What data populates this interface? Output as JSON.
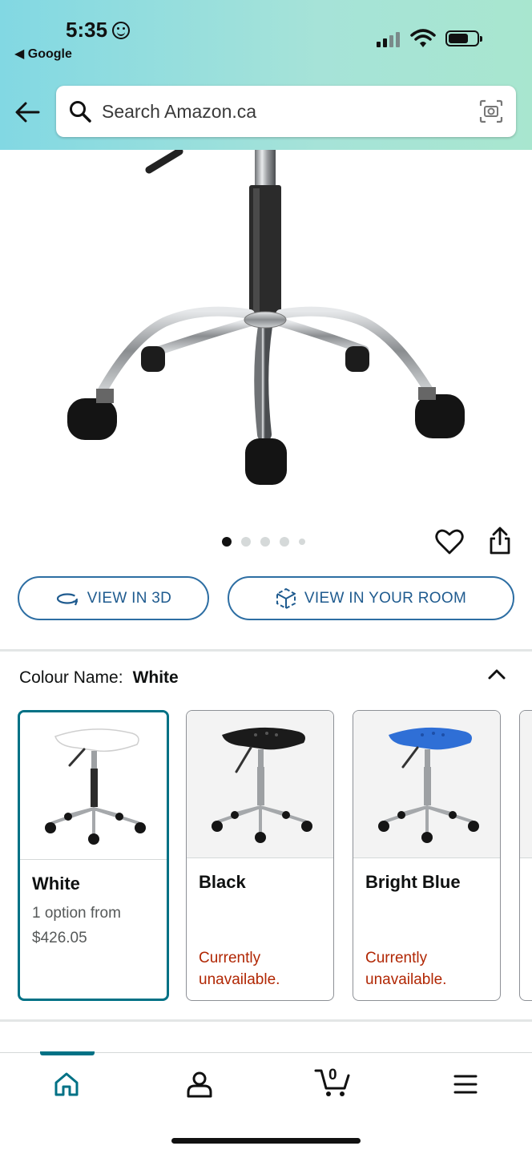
{
  "status_bar": {
    "time": "5:35",
    "back_app": "◀ Google"
  },
  "search": {
    "placeholder": "Search Amazon.ca"
  },
  "carousel": {
    "total_images": 5,
    "active_index": 0
  },
  "buttons": {
    "view_3d": "VIEW IN 3D",
    "view_room": "VIEW IN YOUR ROOM"
  },
  "colour": {
    "label": "Colour Name:",
    "selected": "White",
    "swatches": [
      {
        "name": "White",
        "sub": "1 option from",
        "price": "$426.05",
        "seat_color": "#ffffff"
      },
      {
        "name": "Black",
        "status_line1": "Currently",
        "status_line2": "unavailable.",
        "seat_color": "#1b1b1b"
      },
      {
        "name": "Bright Blue",
        "status_line1": "Currently",
        "status_line2": "unavailable.",
        "seat_color": "#2f6fd6"
      }
    ]
  },
  "nav": {
    "cart_count": "0"
  },
  "colors": {
    "accent": "#007185",
    "button_border": "#2d6ea3",
    "unavailable": "#b12704"
  }
}
